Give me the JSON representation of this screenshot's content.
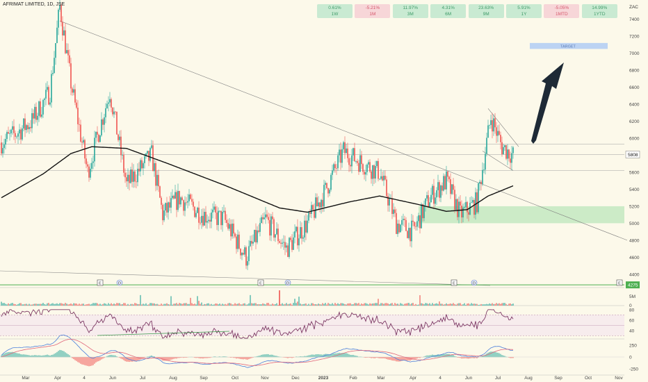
{
  "header": {
    "symbol_line": "AFRIMAT LIMITED, 1D, JSE",
    "currency": "ZAC"
  },
  "performance": [
    {
      "value": "0.61%",
      "label": "1W",
      "tone": "pos"
    },
    {
      "value": "-5.21%",
      "label": "1M",
      "tone": "neg"
    },
    {
      "value": "11.97%",
      "label": "3M",
      "tone": "pos"
    },
    {
      "value": "4.31%",
      "label": "6M",
      "tone": "pos"
    },
    {
      "value": "23.63%",
      "label": "9M",
      "tone": "pos"
    },
    {
      "value": "5.91%",
      "label": "1Y",
      "tone": "pos"
    },
    {
      "value": "-5.05%",
      "label": "1MTD",
      "tone": "neg"
    },
    {
      "value": "14.99%",
      "label": "1YTD",
      "tone": "pos"
    }
  ],
  "annotations": {
    "target_label": "TARGET",
    "last_price": "5808",
    "support_price": "4275",
    "event_e": "E",
    "event_d": "D"
  },
  "colors": {
    "up": "#26a69a",
    "down": "#ef5350",
    "ma": "#111111",
    "rsi": "#7e3a66",
    "macd": "#4a7fdb",
    "signal": "#e0667a",
    "zone": "#c6e9c3",
    "target": "#bcd3f3",
    "support": "#4caf50",
    "background": "#fcf9ea"
  },
  "chart_data": {
    "type": "candlestick",
    "title": "AFRIMAT LIMITED, 1D, JSE",
    "y_axis": {
      "ticks": [
        4400,
        4600,
        4800,
        5000,
        5200,
        5400,
        5600,
        5800,
        6000,
        6200,
        6400,
        6600,
        6800,
        7000,
        7200,
        7400
      ],
      "ylim": [
        4260,
        7560
      ],
      "currency": "ZAC",
      "position": "right"
    },
    "x_axis": {
      "ticks": [
        "Mar",
        "Apr",
        "4",
        "Jun",
        "Jul",
        "Aug",
        "Sep",
        "Oct",
        "Nov",
        "Dec",
        "2023",
        "Feb",
        "Mar",
        "Apr",
        "4",
        "Jun",
        "Jul",
        "Aug",
        "Sep",
        "Oct",
        "Nov"
      ]
    },
    "price_anchors": [
      {
        "i": 0,
        "p": 5950
      },
      {
        "i": 10,
        "p": 6050
      },
      {
        "i": 22,
        "p": 6200
      },
      {
        "i": 35,
        "p": 6550
      },
      {
        "i": 42,
        "p": 7550
      },
      {
        "i": 50,
        "p": 6650
      },
      {
        "i": 62,
        "p": 5600
      },
      {
        "i": 78,
        "p": 6550
      },
      {
        "i": 90,
        "p": 5450
      },
      {
        "i": 108,
        "p": 5800
      },
      {
        "i": 116,
        "p": 5100
      },
      {
        "i": 128,
        "p": 5300
      },
      {
        "i": 145,
        "p": 5100
      },
      {
        "i": 160,
        "p": 5050
      },
      {
        "i": 176,
        "p": 4600
      },
      {
        "i": 190,
        "p": 5050
      },
      {
        "i": 205,
        "p": 4700
      },
      {
        "i": 220,
        "p": 5000
      },
      {
        "i": 232,
        "p": 5350
      },
      {
        "i": 246,
        "p": 5850
      },
      {
        "i": 260,
        "p": 5700
      },
      {
        "i": 272,
        "p": 5600
      },
      {
        "i": 284,
        "p": 5000
      },
      {
        "i": 296,
        "p": 4900
      },
      {
        "i": 308,
        "p": 5300
      },
      {
        "i": 320,
        "p": 5500
      },
      {
        "i": 330,
        "p": 5100
      },
      {
        "i": 342,
        "p": 5250
      },
      {
        "i": 352,
        "p": 6250
      },
      {
        "i": 360,
        "p": 5900
      },
      {
        "i": 368,
        "p": 5800
      }
    ],
    "moving_average": [
      {
        "i": 0,
        "p": 5300
      },
      {
        "i": 30,
        "p": 5580
      },
      {
        "i": 50,
        "p": 5820
      },
      {
        "i": 65,
        "p": 5900
      },
      {
        "i": 90,
        "p": 5880
      },
      {
        "i": 120,
        "p": 5700
      },
      {
        "i": 160,
        "p": 5450
      },
      {
        "i": 200,
        "p": 5180
      },
      {
        "i": 220,
        "p": 5130
      },
      {
        "i": 250,
        "p": 5250
      },
      {
        "i": 272,
        "p": 5320
      },
      {
        "i": 300,
        "p": 5220
      },
      {
        "i": 320,
        "p": 5140
      },
      {
        "i": 335,
        "p": 5160
      },
      {
        "i": 350,
        "p": 5320
      },
      {
        "i": 368,
        "p": 5440
      }
    ],
    "zones": [
      {
        "from_i": 300,
        "price_low": 5000,
        "price_high": 5200,
        "label": ""
      }
    ],
    "target_box": {
      "from_i": 382,
      "to_i": 438,
      "price_low": 7050,
      "price_high": 7120,
      "label": "TARGET"
    },
    "trendlines": [
      {
        "from": {
          "i": 42,
          "p": 7380
        },
        "to": {
          "i": 450,
          "p": 4800
        }
      },
      {
        "from": {
          "i": 350,
          "p": 6350
        },
        "to": {
          "i": 372,
          "p": 5900
        }
      },
      {
        "from": {
          "i": 346,
          "p": 5850
        },
        "to": {
          "i": 368,
          "p": 5620
        }
      }
    ],
    "horizontal_levels": [
      5930,
      5808,
      5620
    ],
    "support_line": 4275,
    "volume_axis": {
      "ticks": [
        "5M",
        "0"
      ]
    },
    "rsi": {
      "ticks": [
        80,
        60,
        40
      ],
      "overbought": 70,
      "oversold": 30
    },
    "macd": {
      "ticks": [
        250,
        0,
        -250
      ]
    }
  }
}
